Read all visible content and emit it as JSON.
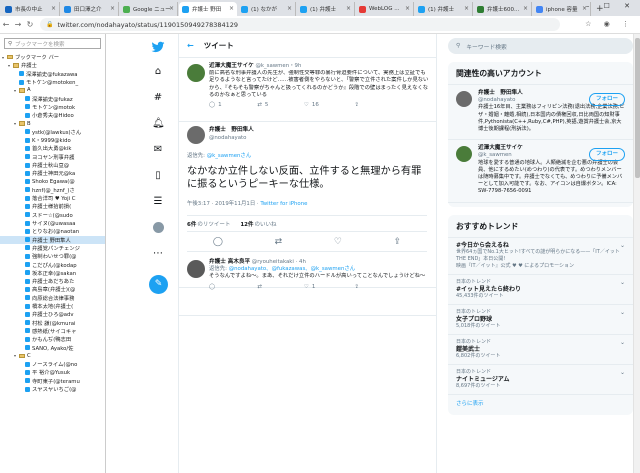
{
  "tabs": [
    {
      "label": "市長の中止",
      "color": "#1565c0"
    },
    {
      "label": "田口澤之介",
      "color": "#1e88e5"
    },
    {
      "label": "Google ニュー",
      "color": "#4caf50"
    },
    {
      "label": "弁護士 野田",
      "color": "#1da1f2"
    },
    {
      "label": "(1) なかが",
      "color": "#1da1f2"
    },
    {
      "label": "(1) 弁護士",
      "color": "#1da1f2"
    },
    {
      "label": "WebLOG ...",
      "color": "#e53935"
    },
    {
      "label": "(1) 弁護士",
      "color": "#1da1f2"
    },
    {
      "label": "弁護士600...",
      "color": "#2e7d32"
    },
    {
      "label": "iphone 容量",
      "color": "#4285f4"
    }
  ],
  "address": {
    "url": "twitter.com/nodahayato/status/1190150949278384129"
  },
  "sidebar": {
    "search_placeholder": "ブックマークを検索",
    "items": [
      {
        "label": "ブックマーク バー",
        "type": "folder",
        "indent": 0
      },
      {
        "label": "弁護士",
        "type": "folder",
        "indent": 1
      },
      {
        "label": "深澤諭史@fukazawa",
        "type": "tw",
        "indent": 2
      },
      {
        "label": "モトケン@motoken_",
        "type": "tw",
        "indent": 2
      },
      {
        "label": "A",
        "type": "folder",
        "indent": 2
      },
      {
        "label": "深澤諭史@fukaz",
        "type": "tw",
        "indent": 3
      },
      {
        "label": "モトケン@motok",
        "type": "tw",
        "indent": 3
      },
      {
        "label": "小倉秀夫@Hideo",
        "type": "tw",
        "indent": 3
      },
      {
        "label": "B",
        "type": "folder",
        "indent": 2
      },
      {
        "label": "ystk(@lawkus)さん",
        "type": "tw",
        "indent": 3
      },
      {
        "label": "K・9999@kido",
        "type": "tw",
        "indent": 3
      },
      {
        "label": "首久出大勇@kik",
        "type": "tw",
        "indent": 3
      },
      {
        "label": "ヨコヤン刑事弁護",
        "type": "tw",
        "indent": 3
      },
      {
        "label": "弁護士秋山亘@",
        "type": "tw",
        "indent": 3
      },
      {
        "label": "弁護士神田元@ka",
        "type": "tw",
        "indent": 3
      },
      {
        "label": "Shoko Egawa(@",
        "type": "tw",
        "indent": 3
      },
      {
        "label": "hznf(@_hznf_)さ",
        "type": "tw",
        "indent": 3
      },
      {
        "label": "落合洋司 ♥ Yoji C",
        "type": "tw",
        "indent": 3
      },
      {
        "label": "弁護士様拾前損(",
        "type": "tw",
        "indent": 3
      },
      {
        "label": "スドー☆(@sudo",
        "type": "tw",
        "indent": 3
      },
      {
        "label": "サイヌ(@uwasaa",
        "type": "tw",
        "indent": 3
      },
      {
        "label": "とりなお(@naotan",
        "type": "tw",
        "indent": 3
      },
      {
        "label": "弁護士 野田隼人",
        "type": "tw",
        "indent": 3,
        "selected": true
      },
      {
        "label": "弁護覚パンチェンジ",
        "type": "tw",
        "indent": 3
      },
      {
        "label": "強制わいせつ罪(@",
        "type": "tw",
        "indent": 3
      },
      {
        "label": "こだぴん(@kodap",
        "type": "tw",
        "indent": 3
      },
      {
        "label": "坂本正幸(@sakan",
        "type": "tw",
        "indent": 3
      },
      {
        "label": "弁護士あだちあた",
        "type": "tw",
        "indent": 3
      },
      {
        "label": "高島章(弁護士)(@",
        "type": "tw",
        "indent": 3
      },
      {
        "label": "向原総合法律事務",
        "type": "tw",
        "indent": 3
      },
      {
        "label": "橋本太地(弁護士(",
        "type": "tw",
        "indent": 3
      },
      {
        "label": "弁護士ひろ@adv",
        "type": "tw",
        "indent": 3
      },
      {
        "label": "村松 謙(@kmurai",
        "type": "tw",
        "indent": 3
      },
      {
        "label": "感熱紙(サイコキャ",
        "type": "tw",
        "indent": 3
      },
      {
        "label": "かもんぢ(鴨志田",
        "type": "tw",
        "indent": 3
      },
      {
        "label": "SANO, Ayako/佐",
        "type": "tw",
        "indent": 3
      },
      {
        "label": "C",
        "type": "folder",
        "indent": 2
      },
      {
        "label": "ノースライム(@no",
        "type": "tw",
        "indent": 3
      },
      {
        "label": "平 裕介@Yusuk",
        "type": "tw",
        "indent": 3
      },
      {
        "label": "寺町東子(@teramu",
        "type": "tw",
        "indent": 3
      },
      {
        "label": "スヤスヤいちご(@",
        "type": "tw",
        "indent": 3
      }
    ]
  },
  "main": {
    "header": "ツイート",
    "tweet1": {
      "name": "近澤大魔王サイケ",
      "handle": "@k_sawmen・9h",
      "text": "前に高名な刑事弁護人の先生が、強制性交等罪の暴行脅迫要件について、実務上は立証でも足りるようなと言ってたけど……被害者側をやらないと、「警察で立件された案件しか見ないから、『そもそも警察がちゃんと扱ってくれるのかどうか』段階での壁はまったく見えなくなるのかなぁと思っている",
      "replies": "1",
      "retweets": "5",
      "likes": "16"
    },
    "main_tweet": {
      "name": "弁護士　野田隼人",
      "handle": "@nodahayato",
      "reply_prefix": "返信先:",
      "reply_to": "@k_sawmenさん",
      "text": "なかなか立件しない反面、立件すると無理から有罪に振るというピーキーな仕様。",
      "time": "午後3:17 · 2019年11月1日 · ",
      "via": "Twitter for iPhone",
      "retweets_count": "6件",
      "retweets_label": "のリツイート",
      "likes_count": "12件",
      "likes_label": "のいいね"
    },
    "tweet3": {
      "name": "弁護士 高木良平",
      "handle": "@ryouheitakaki · 4h",
      "reply_prefix": "返信先:",
      "reply_to": "@nodahayato、@fukazawas、@k_sawmenさん",
      "text": "そうなんですよね〜。まあ、それだけ立件のハードルが高いってことなんでしょうけどね〜",
      "replies": "",
      "retweets": "",
      "likes": "1"
    }
  },
  "right": {
    "search_placeholder": "キーワード検索",
    "related_title": "関連性の高いアカウント",
    "accounts": [
      {
        "name": "弁護士　野田隼人",
        "handle": "@nodahayato",
        "bio": "弁護士16年目、主業務はフィリピン法務(退出法務,企業法務,ビザ・婚姻・離婚,相続),日本国内の債権回収,日比両国の知財事件,Pythonista(C++,Ruby,C#,PHP),英語,遊賞弁護士会,京大博士後期課程(刑訴法)。",
        "follow": "フォロー"
      },
      {
        "name": "近澤大魔王サイケ",
        "handle": "@k_sawmen",
        "bio": "地球を愛する普通の地球人。人類絶滅を企む悪の弁護士の会員、他にするめたい(めつわり)の代表です。めつわりメンバーは随時募集中です。弁護士でなくても、めつわりに予備メンバーとして加入可能です。なお、アイコンは自爆ボタン。ICA: SW-7798-7656-0091",
        "follow": "フォロー"
      }
    ],
    "trends_title": "おすすめトレンド",
    "trends": [
      {
        "meta": "",
        "title": "#今日から会えるね",
        "sub": "世界64ヵ国でNo.1大ヒット!すべての謎が明らかになる——「IT／イット THE END」本日公開!",
        "extra": "映画『IT／イット』公式 ♥ ♥ によるプロモーション"
      },
      {
        "meta": "日本のトレンド",
        "title": "#イット見えたら終わり",
        "sub": "45,433件のツイート",
        "extra": ""
      },
      {
        "meta": "日本のトレンド",
        "title": "女子プロ野球",
        "sub": "5,018件のツイート",
        "extra": ""
      },
      {
        "meta": "日本のトレンド",
        "title": "鎧美武士",
        "sub": "6,802件のツイート",
        "extra": ""
      },
      {
        "meta": "日本のトレンド",
        "title": "ナイトミュージアム",
        "sub": "8,697件のツイート",
        "extra": ""
      }
    ],
    "more": "さらに表示"
  }
}
